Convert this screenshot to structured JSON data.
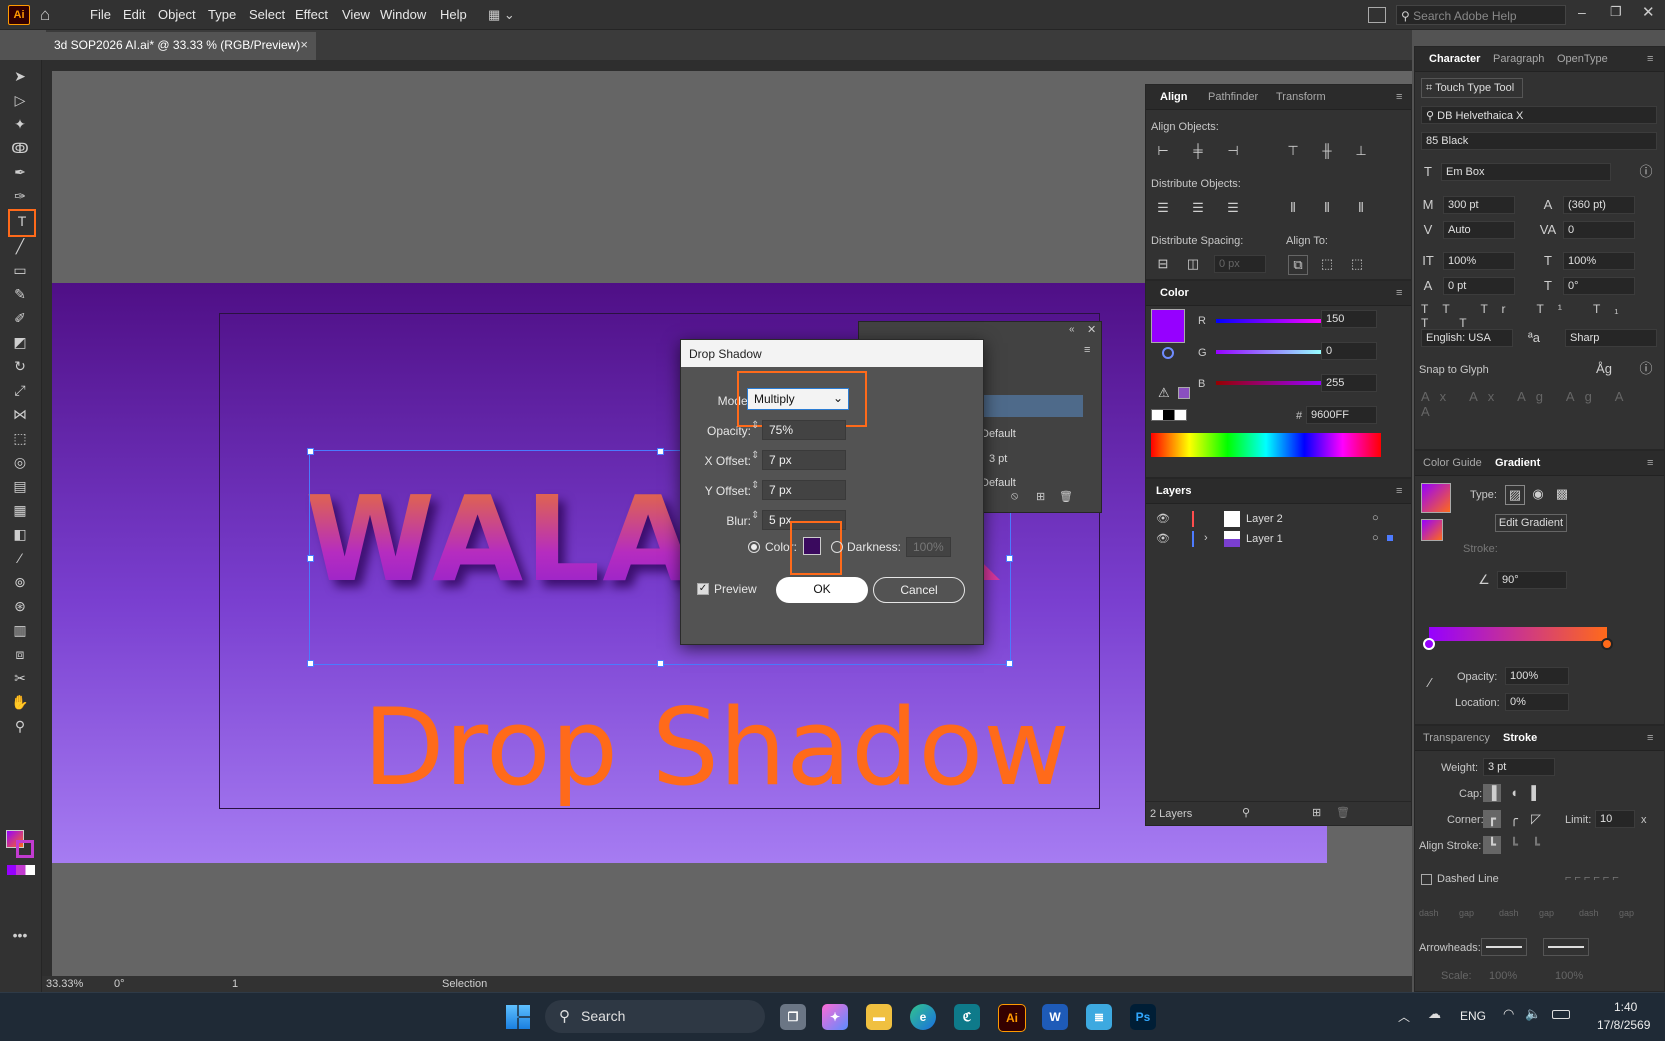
{
  "app": {
    "logo": "Ai"
  },
  "menu": [
    "File",
    "Edit",
    "Object",
    "Type",
    "Select",
    "Effect",
    "View",
    "Window",
    "Help"
  ],
  "search_help": {
    "placeholder": "Search Adobe Help"
  },
  "document_tab": {
    "title": "3d SOP2026 AI.ai* @ 33.33 % (RGB/Preview)",
    "close": "×"
  },
  "artwork": {
    "headline": "WALA",
    "headline_tail": "K",
    "caption": "Drop Shadow"
  },
  "dialog": {
    "title": "Drop Shadow",
    "mode_label": "Mode:",
    "mode_value": "Multiply",
    "opacity_label": "Opacity:",
    "opacity_value": "75%",
    "xoffset_label": "X Offset:",
    "xoffset_value": "7 px",
    "yoffset_label": "Y Offset:",
    "yoffset_value": "7 px",
    "blur_label": "Blur:",
    "blur_value": "5 px",
    "color_label": "Color:",
    "color_value": "#3a0a5e",
    "darkness_label": "Darkness:",
    "darkness_value": "100%",
    "preview_label": "Preview",
    "ok": "OK",
    "cancel": "Cancel"
  },
  "behind_panel": {
    "default1": "Default",
    "weight": "3 pt",
    "default2": "Default"
  },
  "align_panel": {
    "tabs": [
      "Align",
      "Pathfinder",
      "Transform"
    ],
    "align_objects": "Align Objects:",
    "distribute_objects": "Distribute Objects:",
    "distribute_spacing": "Distribute Spacing:",
    "align_to": "Align To:",
    "spacing_value": "0 px"
  },
  "color_panel": {
    "title": "Color",
    "r_label": "R",
    "r": "150",
    "g_label": "G",
    "g": "0",
    "b_label": "B",
    "b": "255",
    "hex_label": "#",
    "hex": "9600FF",
    "swatch": "#9600ff"
  },
  "layers_panel": {
    "title": "Layers",
    "layers": [
      "Layer 2",
      "Layer 1"
    ],
    "count": "2 Layers"
  },
  "character_panel": {
    "tabs": [
      "Character",
      "Paragraph",
      "OpenType"
    ],
    "touch_type": "Touch Type Tool",
    "font_family": "DB Helvethaica X",
    "font_style": "85 Black",
    "em_box": "Em Box",
    "size": "300 pt",
    "leading": "(360 pt)",
    "kerning": "Auto",
    "tracking": "0",
    "vscale": "100%",
    "hscale": "100%",
    "baseline": "0 pt",
    "rotation": "0°",
    "language": "English: USA",
    "antialias": "Sharp",
    "snap_to_glyph": "Snap to Glyph"
  },
  "gradient_panel": {
    "tabs": [
      "Color Guide",
      "Gradient"
    ],
    "type_label": "Type:",
    "edit_gradient": "Edit Gradient",
    "stroke_label": "Stroke:",
    "angle": "90°",
    "opacity_label": "Opacity:",
    "opacity": "100%",
    "location_label": "Location:",
    "location": "0%"
  },
  "stroke_panel": {
    "tabs": [
      "Transparency",
      "Stroke"
    ],
    "weight_label": "Weight:",
    "weight": "3 pt",
    "cap_label": "Cap:",
    "corner_label": "Corner:",
    "limit_label": "Limit:",
    "limit": "10",
    "limit_x": "x",
    "align_label": "Align Stroke:",
    "dashed": "Dashed Line",
    "dash_labels": [
      "dash",
      "gap",
      "dash",
      "gap",
      "dash",
      "gap"
    ],
    "arrowheads": "Arrowheads:",
    "scale_label": "Scale:",
    "scale1": "100%",
    "scale2": "100%"
  },
  "status": {
    "zoom": "33.33%",
    "rotate": "0°",
    "artboard": "1",
    "tool": "Selection"
  },
  "taskbar": {
    "search": "Search",
    "lang": "ENG",
    "time": "1:40",
    "date": "17/8/2569"
  }
}
